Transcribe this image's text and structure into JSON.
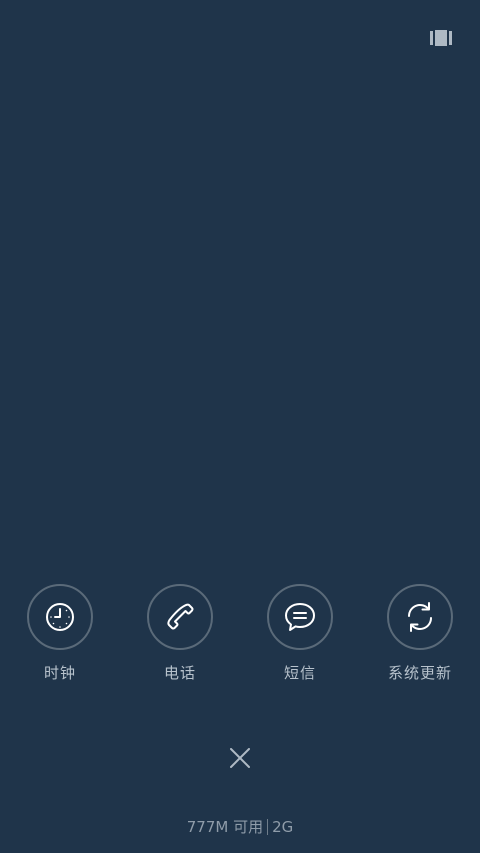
{
  "apps": [
    {
      "label": "时钟",
      "icon": "clock-icon"
    },
    {
      "label": "电话",
      "icon": "phone-icon"
    },
    {
      "label": "短信",
      "icon": "message-icon"
    },
    {
      "label": "系统更新",
      "icon": "refresh-icon"
    }
  ],
  "memory": {
    "available": "777M 可用",
    "total": "2G"
  },
  "colors": {
    "background": "#1f344a",
    "ring": "#5a6a79",
    "icon": "#ffffff",
    "label": "#b7c2cc"
  }
}
